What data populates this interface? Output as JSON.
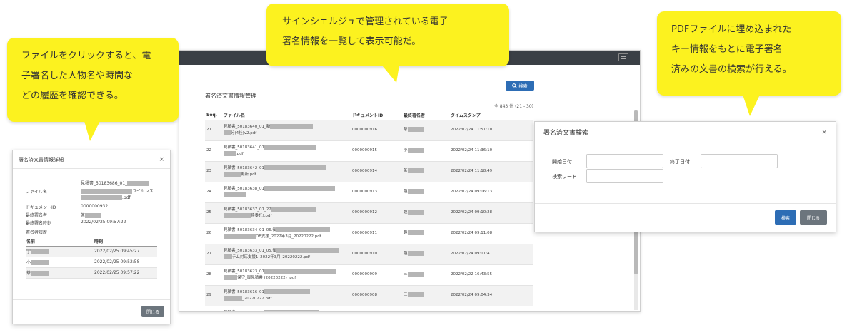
{
  "main": {
    "search_button": "検索",
    "title": "署名済文書情報管理",
    "count": "全 843 件 (21 - 30)",
    "columns": [
      "Seq.",
      "ファイル名",
      "ドキュメントID",
      "最終署名者",
      "タイムスタンプ"
    ],
    "rows": [
      {
        "seq": "21",
        "file1": "見積書_50183640_01_新",
        "file2": "分(4社)v2.pdf",
        "doc": "0000000916",
        "signer": "茶",
        "ts": "2022/02/24 11:51:10"
      },
      {
        "seq": "22",
        "file1": "見積書_50183641_01",
        "file2": ".pdf",
        "doc": "0000000915",
        "signer": "小",
        "ts": "2022/02/24 11:36:10"
      },
      {
        "seq": "23",
        "file1": "見積書_50183642_01",
        "file2": "更新.pdf",
        "doc": "0000000914",
        "signer": "茶",
        "ts": "2022/02/24 11:18:49"
      },
      {
        "seq": "24",
        "file1": "見積書_50183638_01",
        "file2": "",
        "doc": "0000000913",
        "signer": "趣",
        "ts": "2022/02/24 09:06:13"
      },
      {
        "seq": "25",
        "file1": "見積書_50183637_01_22",
        "file2": "務委託).pdf",
        "doc": "0000000912",
        "signer": "趣",
        "ts": "2022/02/24 09:10:28"
      },
      {
        "seq": "26",
        "file1": "見積書_50183634_01_06.御",
        "file2": "DB支援_2022年3月_20220222.pdf",
        "doc": "0000000911",
        "signer": "趣",
        "ts": "2022/02/24 09:11:08"
      },
      {
        "seq": "27",
        "file1": "見積書_50183633_01_05.御",
        "file2": "テム対応支援1_2022年3月_20220222.pdf",
        "doc": "0000000910",
        "signer": "趣",
        "ts": "2022/02/24 09:11:41"
      },
      {
        "seq": "28",
        "file1": "見積書_50183623_01",
        "file2": "保守_御見積書 (20220222) .pdf",
        "doc": "0000000909",
        "signer": "三",
        "ts": "2022/02/22 16:43:55"
      },
      {
        "seq": "29",
        "file1": "見積書_50183616_01",
        "file2": "_20220222.pdf",
        "doc": "0000000908",
        "signer": "三",
        "ts": "2022/02/24 09:04:34"
      },
      {
        "seq": "30",
        "file1": "見積書_50183621_01",
        "file2": "",
        "doc": "0000000907",
        "signer": "茶",
        "ts": "2022/02/22 16:06:04"
      }
    ]
  },
  "detail": {
    "title": "署名済文書情報詳細",
    "close": "×",
    "file_label": "ファイル名",
    "file_value_1": "見積書_50183686_01_",
    "file_value_2": "ライセンス",
    "file_value_3": ".pdf",
    "docid_label": "ドキュメントID",
    "docid_value": "0000000932",
    "signer_label": "最終署名者",
    "signer_value": "茶",
    "time_label": "最終署名時刻",
    "time_value": "2022/02/25 09:57:22",
    "history_label": "署名者履歴",
    "history_cols": [
      "名前",
      "時刻"
    ],
    "history": [
      {
        "name": "宇",
        "time": "2022/02/25 09:45:27"
      },
      {
        "name": "小",
        "time": "2022/02/25 09:52:58"
      },
      {
        "name": "茶",
        "time": "2022/02/25 09:57:22"
      }
    ],
    "close_button": "閉じる"
  },
  "search": {
    "title": "署名済文書検索",
    "close": "×",
    "start_label": "開始日付",
    "end_label": "終了日付",
    "keyword_label": "検索ワード",
    "search_button": "検索",
    "close_button": "閉じる"
  },
  "callouts": {
    "left": [
      "ファイルをクリックすると、電",
      "子署名した人物名や時間な",
      "どの履歴を確認できる。"
    ],
    "center": [
      "サインシェルジュで管理されている電子",
      "署名情報を一覧して表示可能だ。"
    ],
    "right": [
      "PDFファイルに埋め込まれた",
      "キー情報をもとに電子署名",
      "済みの文書の検索が行える。"
    ]
  },
  "colors": {
    "callout": "#fcf21f",
    "primary": "#2d6db5",
    "secondary": "#6c757d",
    "topbar": "#3a3f45"
  }
}
